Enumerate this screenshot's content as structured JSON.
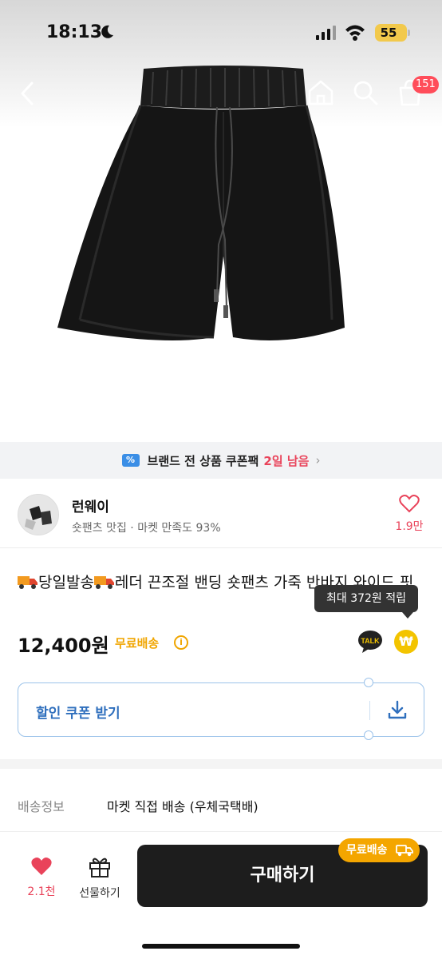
{
  "status_bar": {
    "time": "18:13",
    "battery": "55"
  },
  "nav": {
    "cart_count": "151"
  },
  "coupon_banner": {
    "text": "브랜드 전 상품 쿠폰팩",
    "remaining": "2일 남음"
  },
  "shop": {
    "name": "런웨이",
    "description": "숏팬츠 맛집 · 마켓 만족도 93%",
    "likes": "1.9만"
  },
  "product": {
    "title_a": "당일발송",
    "title_b": "레더 끈조절 밴딩 숏팬츠 가죽 반바지 와이드 핏",
    "tooltip": "최대 372원 적립",
    "price": "12,400원",
    "free_shipping": "무료배송",
    "talk_label": "TALK",
    "point_symbol": "₩"
  },
  "coupon_box": {
    "label": "할인 쿠폰 받기"
  },
  "delivery": {
    "key": "배송정보",
    "value": "마켓 직접 배송 (우체국택배)"
  },
  "bottom_bar": {
    "like_count": "2.1천",
    "gift_label": "선물하기",
    "buy_label": "구매하기",
    "ship_pill": "무료배송"
  },
  "colors": {
    "accent_red": "#e9435a",
    "coupon_blue": "#2f6fbd",
    "ship_orange": "#f4a600",
    "buy_dark": "#1d1d1d"
  }
}
